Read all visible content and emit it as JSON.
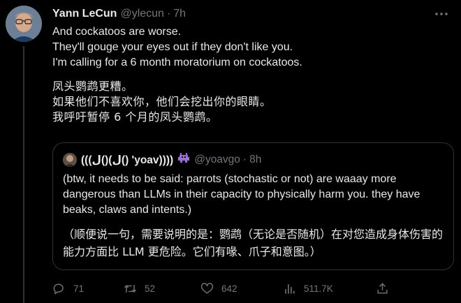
{
  "tweet": {
    "author_name": "Yann LeCun",
    "author_handle": "@ylecun",
    "separator": "·",
    "time": "7h",
    "text_en": "And cockatoos are worse.\nThey'll gouge your eyes out if they don't like you.\nI'm calling for a 6 month moratorium on cockatoos.",
    "text_zh": "凤头鹦鹉更糟。\n如果他们不喜欢你，他们会挖出你的眼睛。\n我呼吁暂停 6 个月的凤头鹦鹉。"
  },
  "quote": {
    "author_name": "(((ل()(ل() 'yoav))))",
    "badge": "👾",
    "author_handle": "@yoavgo",
    "separator": "·",
    "time": "8h",
    "text_en": "(btw, it needs to be said: parrots (stochastic or not) are waaay more dangerous than LLMs in their capacity to physically harm you. they have beaks, claws and intents.)",
    "text_zh": "（顺便说一句，需要说明的是：鹦鹉（无论是否随机）在对您造成身体伤害的能力方面比 LLM 更危险。它们有喙、爪子和意图。）"
  },
  "actions": {
    "replies": "71",
    "retweets": "52",
    "likes": "642",
    "views": "511.7K"
  },
  "icons": {
    "reply": "reply-icon",
    "retweet": "retweet-icon",
    "like": "heart-icon",
    "views": "views-icon",
    "share": "share-icon",
    "more": "more-icon"
  },
  "colors": {
    "background": "#000000",
    "text": "#e7e9ea",
    "muted": "#71767b",
    "border": "#2f3336"
  }
}
